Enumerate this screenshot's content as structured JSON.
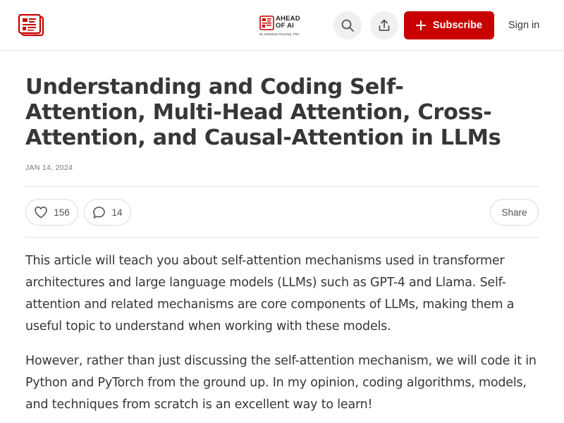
{
  "header": {
    "publication_name": "AHEAD OF AI",
    "byline": "By Sebastian Raschka, PhD",
    "subscribe_label": "Subscribe",
    "signin_label": "Sign in",
    "icons": [
      "publication-logo-icon",
      "search-icon",
      "share-icon",
      "plus-icon"
    ]
  },
  "article": {
    "title": "Understanding and Coding Self-Attention, Multi-Head Attention, Cross-Attention, and Causal-Attention in LLMs",
    "date": "JAN 14, 2024",
    "likes": "156",
    "comments": "14",
    "share_label": "Share",
    "paragraphs": [
      "This article will teach you about self-attention mechanisms used in transformer architectures and large language models (LLMs) such as GPT-4 and Llama. Self-attention and related mechanisms are core components of LLMs, making them a useful topic to understand when working with these models.",
      "However, rather than just discussing the self-attention mechanism, we will code it in Python and PyTorch from the ground up. In my opinion, coding algorithms, models, and techniques from scratch is an excellent way to learn!"
    ]
  },
  "colors": {
    "accent": "#c90000",
    "text": "#363737",
    "muted": "#757575",
    "divider": "#e0e0e0"
  }
}
